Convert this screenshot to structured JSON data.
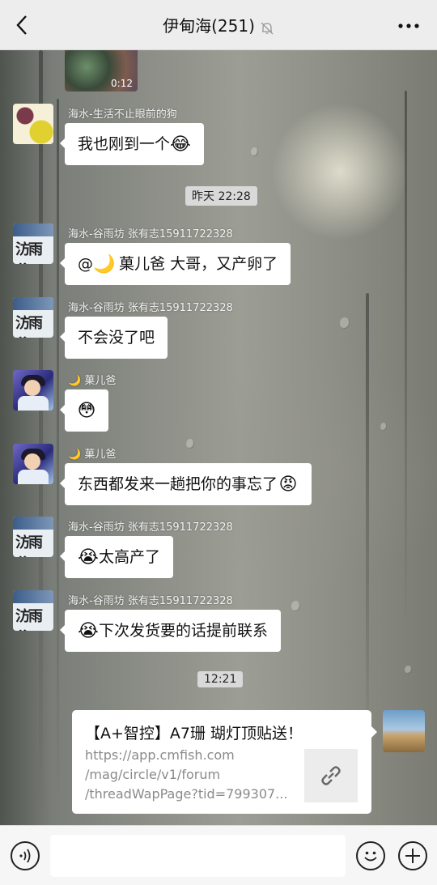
{
  "header": {
    "title": "伊甸海(251)",
    "back_icon": "back-chevron-icon",
    "mute_icon": "muted-bell-icon",
    "more_icon": "more-dots-icon"
  },
  "video": {
    "duration": "0:12"
  },
  "messages": [
    {
      "sender": "海水-生活不止眼前的狗",
      "text": "我也刚到一个",
      "emoji": "😂",
      "avatar": "flower"
    },
    {
      "timestamp": "昨天 22:28"
    },
    {
      "sender": "海水-谷雨坊 张有志15911722328",
      "text_prefix": "@",
      "moon": "🌙",
      "text": " 菓儿爸  大哥，又产卵了",
      "avatar": "stamp"
    },
    {
      "sender": "海水-谷雨坊 张有志15911722328",
      "text": "不会没了吧",
      "avatar": "stamp"
    },
    {
      "sender_moon": "🌙",
      "sender": " 菓儿爸",
      "emoji": "😳",
      "avatar": "anime"
    },
    {
      "sender_moon": "🌙",
      "sender": " 菓儿爸",
      "text": "东西都发来一趟把你的事忘了",
      "emoji": "😡",
      "avatar": "anime"
    },
    {
      "sender": "海水-谷雨坊 张有志15911722328",
      "emoji": "😭",
      "text": "太高产了",
      "avatar": "stamp"
    },
    {
      "sender": "海水-谷雨坊 张有志15911722328",
      "emoji": "😭",
      "text": "下次发货要的话提前联系",
      "avatar": "stamp"
    },
    {
      "timestamp": "12:21"
    }
  ],
  "avatar_glyph": "汸雨谷",
  "link_card": {
    "title": "【A+智控】A7珊 瑚灯顶贴送！",
    "url_lines": [
      "https://app.cmfish.com",
      "/mag/circle/v1/forum",
      "/threadWapPage?tid=799307..."
    ],
    "link_icon": "link-icon"
  },
  "bottom": {
    "voice_icon": "voice-icon",
    "emoji_icon": "emoji-icon",
    "plus_icon": "plus-icon"
  },
  "colors": {
    "bubble": "#ffffff",
    "bar": "#ededed",
    "timestamp_bg": "#d9d9d9"
  }
}
